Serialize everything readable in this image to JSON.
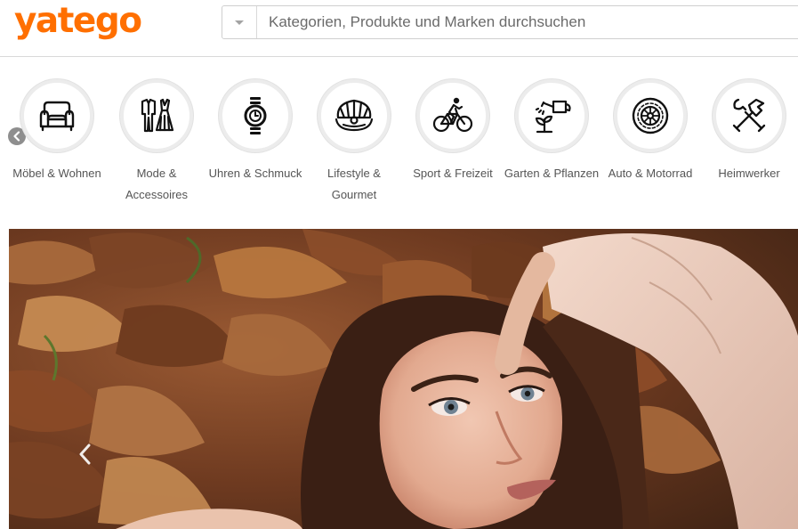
{
  "brand": {
    "logo_text": "yatego",
    "color": "#ff6f00"
  },
  "search": {
    "placeholder": "Kategorien, Produkte und Marken durchsuchen",
    "value": ""
  },
  "categories": [
    {
      "label": "Möbel & Wohnen",
      "icon": "armchair-icon"
    },
    {
      "label": "Mode & Accessoires",
      "icon": "clothing-icon"
    },
    {
      "label": "Uhren & Schmuck",
      "icon": "watch-icon"
    },
    {
      "label": "Lifestyle & Gourmet",
      "icon": "shell-icon"
    },
    {
      "label": "Sport & Freizeit",
      "icon": "cyclist-icon"
    },
    {
      "label": "Garten & Pflanzen",
      "icon": "watering-can-icon"
    },
    {
      "label": "Auto & Motorrad",
      "icon": "tire-icon"
    },
    {
      "label": "Heimwerker",
      "icon": "tools-icon"
    }
  ],
  "hero": {
    "image": "woman-lying-in-autumn-leaves"
  }
}
